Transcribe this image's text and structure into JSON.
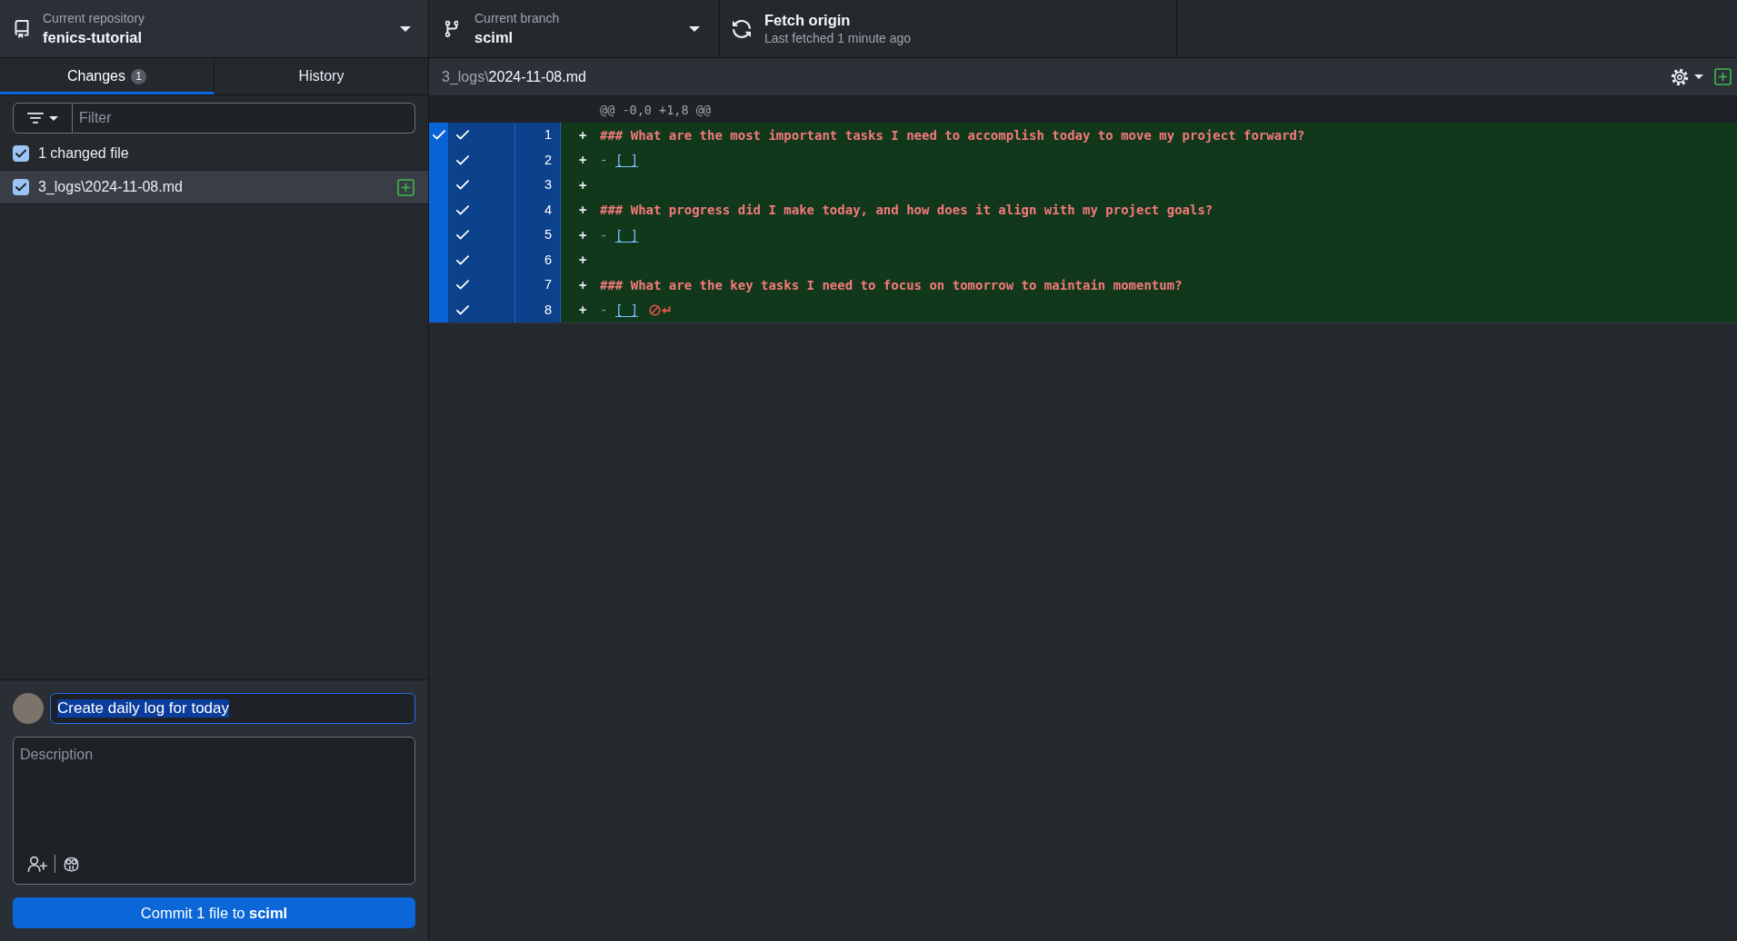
{
  "top_bar": {
    "repository": {
      "label": "Current repository",
      "name": "fenics-tutorial"
    },
    "branch": {
      "label": "Current branch",
      "name": "sciml"
    },
    "fetch": {
      "title": "Fetch origin",
      "subtitle": "Last fetched 1 minute ago"
    }
  },
  "sidebar": {
    "tabs": [
      {
        "label": "Changes",
        "badge": "1",
        "selected": true
      },
      {
        "label": "History",
        "selected": false
      }
    ],
    "filter": {
      "placeholder": "Filter"
    },
    "select_all": {
      "label": "1 changed file",
      "checked": true
    },
    "files": [
      {
        "path": "3_logs\\2024-11-08.md",
        "checked": true,
        "selected": true,
        "kind": "added"
      }
    ],
    "commit": {
      "summary": "Create daily log for today",
      "summary_highlighted": true,
      "description_placeholder": "Description",
      "button": "Commit 1 file to **sciml**"
    }
  },
  "diff": {
    "directory": "3_logs\\",
    "filename": "2024-11-08.md",
    "kind": "added",
    "hunk_header": "@@ -0,0 +1,8 @@",
    "hunk_selected": true,
    "lines": [
      {
        "number": "1",
        "selected": true,
        "prefix": "+",
        "kind": "heading",
        "text": "### What are the most important tasks I need to accomplish today to move my project forward?",
        "no_newline": false
      },
      {
        "number": "2",
        "selected": true,
        "prefix": "+",
        "kind": "task",
        "bullet": "-",
        "box": "[ ]",
        "no_newline": false
      },
      {
        "number": "3",
        "selected": true,
        "prefix": "+",
        "kind": "blank",
        "no_newline": false
      },
      {
        "number": "4",
        "selected": true,
        "prefix": "+",
        "kind": "heading",
        "text": "### What progress did I make today, and how does it align with my project goals?",
        "no_newline": false
      },
      {
        "number": "5",
        "selected": true,
        "prefix": "+",
        "kind": "task",
        "bullet": "-",
        "box": "[ ]",
        "no_newline": false
      },
      {
        "number": "6",
        "selected": true,
        "prefix": "+",
        "kind": "blank",
        "no_newline": false
      },
      {
        "number": "7",
        "selected": true,
        "prefix": "+",
        "kind": "heading",
        "text": "### What are the key tasks I need to focus on tomorrow to maintain momentum?",
        "no_newline": false
      },
      {
        "number": "8",
        "selected": true,
        "prefix": "+",
        "kind": "task",
        "bullet": "-",
        "box": "[ ]",
        "no_newline": true
      }
    ]
  }
}
